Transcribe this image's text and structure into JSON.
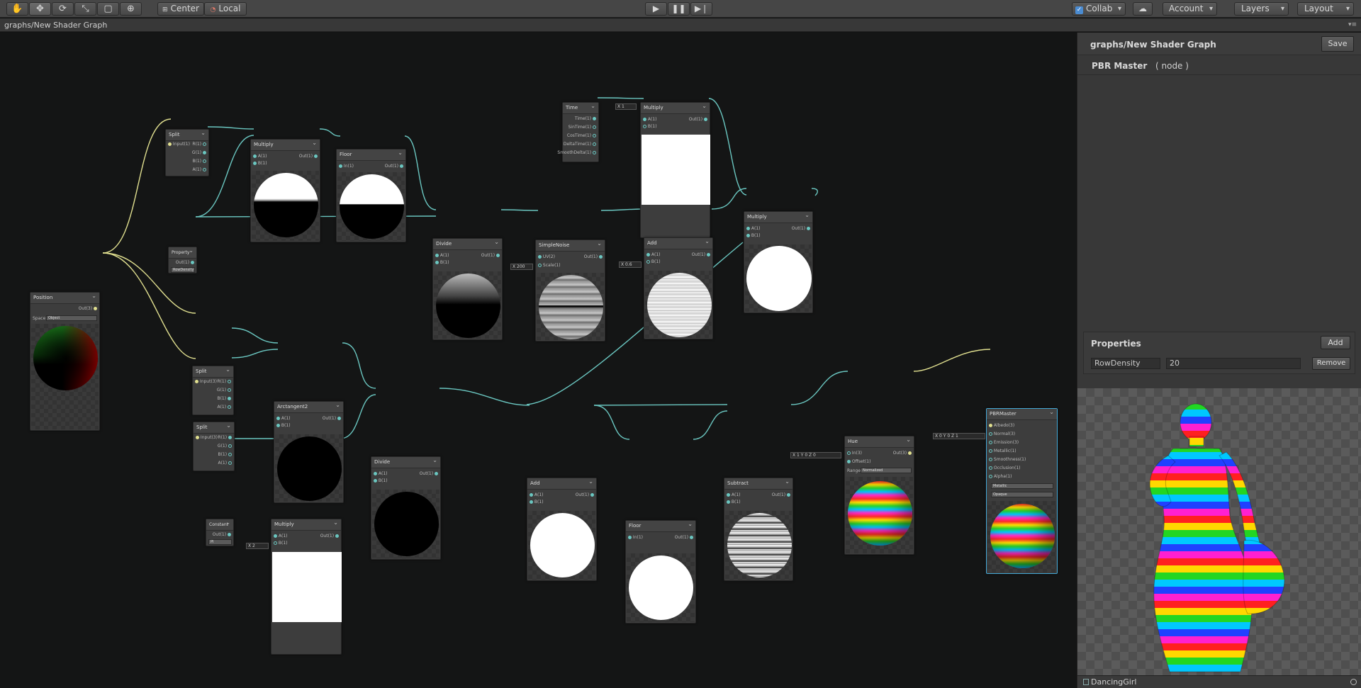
{
  "toolbar": {
    "center_label": "Center",
    "local_label": "Local",
    "collab_label": "Collab",
    "account_label": "Account",
    "layers_label": "Layers",
    "layout_label": "Layout"
  },
  "graph": {
    "title": "graphs/New Shader Graph"
  },
  "nodes": {
    "split_top": {
      "title": "Split",
      "in": [
        "Input(1)"
      ],
      "out": [
        "R(1)",
        "G(1)",
        "B(1)",
        "A(1)"
      ]
    },
    "multiply_top": {
      "title": "Multiply",
      "in": [
        "A(1)",
        "B(1)"
      ],
      "out": "Out(1)"
    },
    "floor_top": {
      "title": "Floor",
      "in": "In(1)",
      "out": "Out(1)"
    },
    "time": {
      "title": "Time",
      "out": [
        "Time(1)",
        "SinTime(1)",
        "CosTime(1)",
        "DeltaTime(1)",
        "SmoothDelta(1)"
      ]
    },
    "multiply_time": {
      "title": "Multiply",
      "in": [
        "A(1)",
        "B(1)"
      ],
      "out": "Out(1)",
      "field": "X 1"
    },
    "property": {
      "title": "Property",
      "out": "Out(1)",
      "field": "RowDensity"
    },
    "divide_top": {
      "title": "Divide",
      "in": [
        "A(1)",
        "B(1)"
      ],
      "out": "Out(1)"
    },
    "simple_noise": {
      "title": "SimpleNoise",
      "in": [
        "UV(2)",
        "Scale(1)"
      ],
      "out": "Out(1)",
      "field": "X 200"
    },
    "add_top": {
      "title": "Add",
      "in": [
        "A(1)",
        "B(1)"
      ],
      "out": "Out(1)",
      "field": "X 0.6"
    },
    "multiply_right": {
      "title": "Multiply",
      "in": [
        "A(1)",
        "B(1)"
      ],
      "out": "Out(1)"
    },
    "position": {
      "title": "Position",
      "out": "Out(3)",
      "space_label": "Space",
      "space_value": "Object"
    },
    "split_mid": {
      "title": "Split",
      "in": "Input(3)",
      "out": [
        "R(1)",
        "G(1)",
        "B(1)",
        "A(1)"
      ]
    },
    "split_low": {
      "title": "Split",
      "in": "Input(3)",
      "out": [
        "R(1)",
        "G(1)",
        "B(1)",
        "A(1)"
      ]
    },
    "arctangent2": {
      "title": "Arctangent2",
      "in": [
        "A(1)",
        "B(1)"
      ],
      "out": "Out(1)"
    },
    "divide_low": {
      "title": "Divide",
      "in": [
        "A(1)",
        "B(1)"
      ],
      "out": "Out(1)"
    },
    "constant": {
      "title": "Constant",
      "out": "Out(1)",
      "field": "PI"
    },
    "multiply_low": {
      "title": "Multiply",
      "in": [
        "A(1)",
        "B(1)"
      ],
      "out": "Out(1)",
      "field": "X 2"
    },
    "add_low": {
      "title": "Add",
      "in": [
        "A(1)",
        "B(1)"
      ],
      "out": "Out(1)"
    },
    "floor_low": {
      "title": "Floor",
      "in": "In(1)",
      "out": "Out(1)"
    },
    "subtract": {
      "title": "Subtract",
      "in": [
        "A(1)",
        "B(1)"
      ],
      "out": "Out(1)"
    },
    "hue": {
      "title": "Hue",
      "in": [
        "In(3)",
        "Offset(1)"
      ],
      "out": "Out(3)",
      "range_label": "Range",
      "range_value": "Normalized",
      "field": "X 1 Y 0 Z 0"
    },
    "pbr_master": {
      "title": "PBRMaster",
      "in": [
        "Albedo(3)",
        "Normal(3)",
        "Emission(3)",
        "Metallic(1)",
        "Smoothness(1)",
        "Occlusion(1)",
        "Alpha(1)"
      ],
      "dd1": "Metallic",
      "dd2": "Opaque",
      "field": "X 0 Y 0 Z 1"
    }
  },
  "inspector": {
    "title": "graphs/New Shader Graph",
    "save_label": "Save",
    "master_name": "PBR Master",
    "master_kind": "( node )",
    "properties_title": "Properties",
    "add_label": "Add",
    "property_name": "RowDensity",
    "property_value": "20",
    "remove_label": "Remove",
    "mesh_name": "DancingGirl"
  },
  "colors": {
    "wire_vector": "#e0df8f",
    "wire_float": "#6ac6c0",
    "selection": "#43a8d6",
    "canvas_bg": "#141515"
  }
}
